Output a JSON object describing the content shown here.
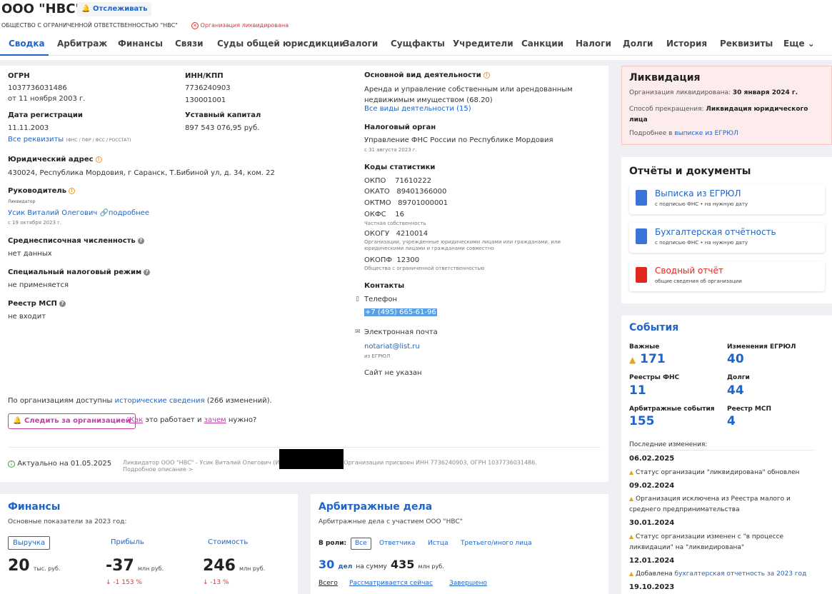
{
  "header": {
    "company": "ООО \"НВС\"",
    "follow": "Отслеживать",
    "full_name": "ОБЩЕСТВО С ОГРАНИЧЕННОЙ ОТВЕТСТВЕННОСТЬЮ \"НВС\"",
    "status": "Организация ликвидирована"
  },
  "tabs": [
    "Сводка",
    "Арбитраж",
    "Финансы",
    "Связи",
    "Суды общей юрисдикции",
    "Залоги",
    "Сущфакты",
    "Учредители",
    "Санкции",
    "Налоги",
    "Долги",
    "История",
    "Реквизиты",
    "Еще"
  ],
  "main": {
    "ogrn_label": "ОГРН",
    "ogrn": "1037736031486",
    "ogrn_date": "от 11 ноября 2003 г.",
    "inn_label": "ИНН/КПП",
    "inn": "7736240903",
    "kpp": "130001001",
    "reg_label": "Дата регистрации",
    "reg_date": "11.11.2003",
    "all_req": "Все реквизиты",
    "all_req_sub": "(ФНС / ПФР / ФСС / РОССТАТ)",
    "capital_label": "Уставный капитал",
    "capital": "897 543 076,95 руб.",
    "address_label": "Юридический адрес",
    "address": "430024, Республика Мордовия, г Саранск, Т.Бибиной ул, д. 34, ком. 22",
    "head_label": "Руководитель",
    "head_role": "Ликвидатор",
    "head_name": "Усик Виталий Олегович",
    "head_more": "подробнее",
    "head_since": "с 19 октября 2023 г.",
    "staff_label": "Среднесписочная численность",
    "staff": "нет данных",
    "tax_label": "Специальный налоговый режим",
    "tax": "не применяется",
    "msp_label": "Реестр МСП",
    "msp": "не входит",
    "activity_label": "Основной вид деятельности",
    "activity": "Аренда и управление собственным или арендованным недвижимым имуществом",
    "activity_code": "(68.20)",
    "activity_all": "Все виды деятельности (15)",
    "taxorg_label": "Налоговый орган",
    "taxorg": "Управление ФНС России по Республике Мордовия",
    "taxorg_date": "с 31 августа 2023 г.",
    "codes_label": "Коды статистики",
    "okpo": "ОКПО    71610222",
    "okato": "ОКАТО   89401366000",
    "oktmo": "ОКТМО   89701000001",
    "okfs": "ОКФС    16",
    "okfs_sub": "Частная собственность",
    "okogu": "ОКОГУ   4210014",
    "okogu_sub": "Организации, учрежденные юридическими лицами или гражданами, или юридическими лицами и гражданами совместно",
    "okopf": "ОКОПФ  12300",
    "okopf_sub": "Общества с ограниченной ответственностью",
    "contacts_label": "Контакты",
    "phone_label": "Телефон",
    "phone": "+7 (495) 665-61-96",
    "email_label": "Электронная почта",
    "email": "notariat@list.ru",
    "email_src": "из ЕГРЮЛ",
    "site": "Сайт не указан",
    "history_pre": "По организациям доступны ",
    "history_link": "исторические сведения",
    "history_post": " (266 изменений).",
    "follow_btn": "Следить за организацией",
    "how": "Как",
    "how_mid": " это работает и ",
    "why": "зачем",
    "why_post": " нужно?",
    "actual": "Актуально на 01.05.2025",
    "news1": "Ликвидатор ООО \"НВС\" - Усик Виталий Олегович (И",
    "news2": "Организации присвоен ИНН 7736240903, ОГРН 1037736031486.",
    "news_more": "Подробное описание >"
  },
  "liquidation": {
    "title": "Ликвидация",
    "l1": "Организация ликвидирована: ",
    "d1": "30 января 2024 г.",
    "l2": "Способ прекращения: ",
    "d2": "Ликвидация юридического лица",
    "l3": "Подробнее в ",
    "link": "выписке из ЕГРЮЛ"
  },
  "reports": {
    "title": "Отчёты и документы",
    "items": [
      {
        "t": "Выписка из ЕГРЮЛ",
        "s": "с подписью ФНС • на нужную дату"
      },
      {
        "t": "Бухгалтерская отчётность",
        "s": "с подписью ФНС • на нужную дату"
      },
      {
        "t": "Сводный отчёт",
        "s": "общие сведения об организации"
      }
    ]
  },
  "events": {
    "title": "События",
    "items": [
      {
        "l": "Важные",
        "n": "171"
      },
      {
        "l": "Изменения ЕГРЮЛ",
        "n": "40"
      },
      {
        "l": "Реестры ФНС",
        "n": "11"
      },
      {
        "l": "Долги",
        "n": "44"
      },
      {
        "l": "Арбитражные события",
        "n": "155"
      },
      {
        "l": "Реестр МСП",
        "n": "4"
      }
    ],
    "last": "Последние изменения:",
    "changes": [
      {
        "d": "06.02.2025",
        "t": "Статус организации \"ликвидирована\" обновлен"
      },
      {
        "d": "09.02.2024",
        "t": "Организация исключена из Реестра малого и среднего предпринимательства"
      },
      {
        "d": "30.01.2024",
        "t": "Статус организации изменен с \"в процессе ликвидации\" на \"ликвидирована\""
      },
      {
        "d": "12.01.2024",
        "t": "Добавлена ",
        "link": "бухгалтерская отчетность за 2023 год"
      },
      {
        "d": "19.10.2023",
        "t": ""
      }
    ]
  },
  "finance": {
    "title": "Финансы",
    "sub": "Основные показатели за 2023 год:",
    "cols": [
      {
        "l": "Выручка",
        "v": "20",
        "u": "тыс. руб.",
        "c": ""
      },
      {
        "l": "Прибыль",
        "v": "-37",
        "u": "млн руб.",
        "c": "↓ -1 153 %"
      },
      {
        "l": "Стоимость",
        "v": "246",
        "u": "млн руб.",
        "c": "↓ -13 %"
      }
    ]
  },
  "arbitr": {
    "title": "Арбитражные дела",
    "sub": "Арбитражные дела с участием ООО \"НВС\"",
    "role": "В роли:",
    "roles": [
      "Все",
      "Ответчика",
      "Истца",
      "Третьего/иного лица"
    ],
    "count": "30",
    "count_u": "дел",
    "sum_l": "на сумму",
    "sum": "435",
    "sum_u": "млн руб.",
    "filters": [
      "Всего",
      "Рассматривается сейчас",
      "Завершено"
    ]
  }
}
